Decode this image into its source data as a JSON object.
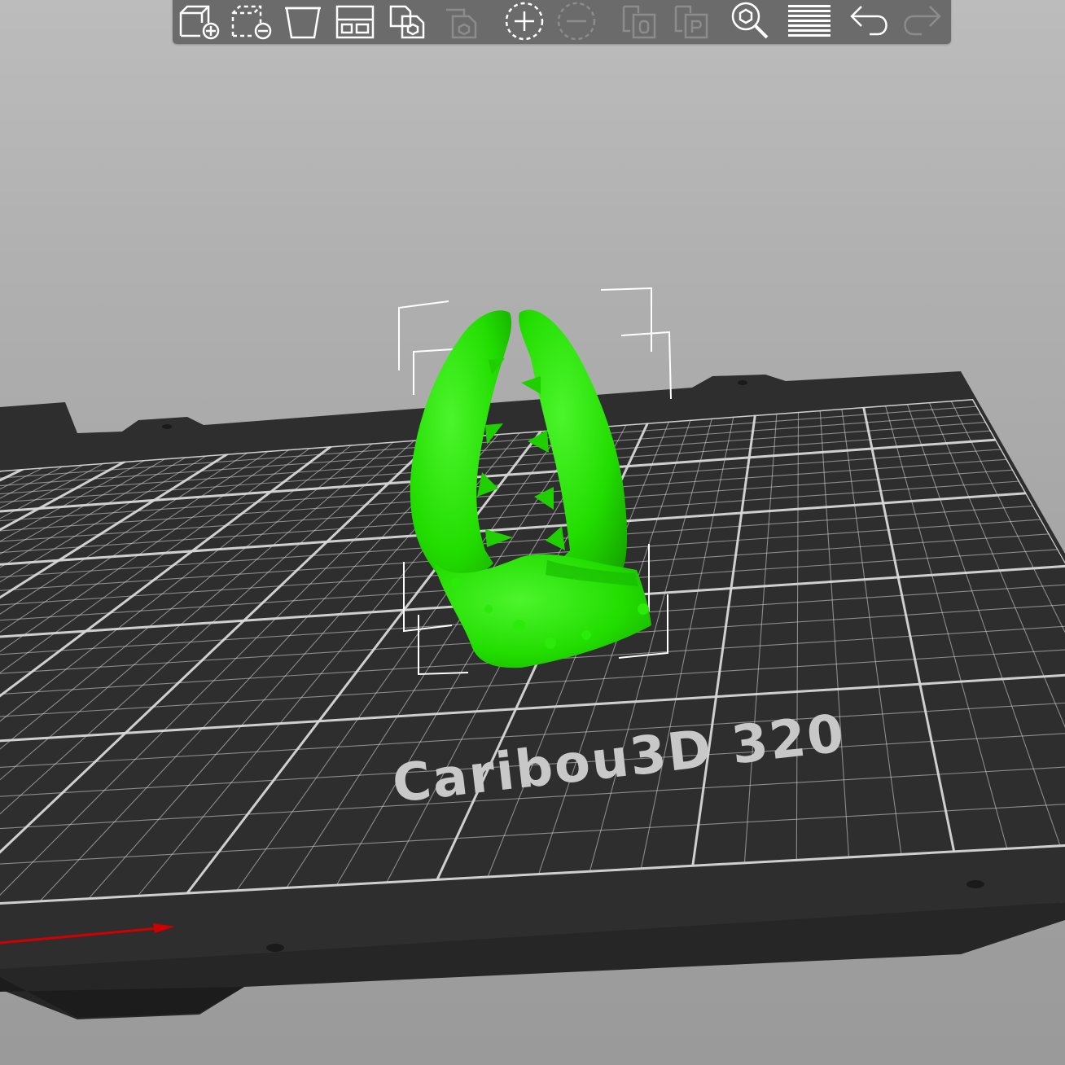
{
  "toolbar": {
    "buttons": [
      {
        "name": "add-object-button",
        "icon": "add-object-icon",
        "enabled": true
      },
      {
        "name": "delete-object-button",
        "icon": "delete-object-icon",
        "enabled": true
      },
      {
        "name": "delete-all-button",
        "icon": "delete-all-icon",
        "enabled": true
      },
      {
        "name": "arrange-button",
        "icon": "arrange-icon",
        "enabled": true
      },
      {
        "name": "copy-button",
        "icon": "copy-icon",
        "enabled": true
      },
      {
        "name": "paste-button",
        "icon": "paste-icon",
        "enabled": false
      },
      {
        "name": "add-instance-button",
        "icon": "add-instance-icon",
        "enabled": true
      },
      {
        "name": "remove-instance-button",
        "icon": "remove-instance-icon",
        "enabled": false
      },
      {
        "name": "split-to-objects-button",
        "icon": "split-objects-icon",
        "enabled": false
      },
      {
        "name": "split-to-parts-button",
        "icon": "split-parts-icon",
        "enabled": false
      },
      {
        "name": "search-button",
        "icon": "search-icon",
        "enabled": true
      },
      {
        "name": "variable-layer-height-button",
        "icon": "layers-icon",
        "enabled": true
      },
      {
        "name": "undo-button",
        "icon": "undo-icon",
        "enabled": true
      },
      {
        "name": "redo-button",
        "icon": "redo-icon",
        "enabled": false
      }
    ]
  },
  "bed": {
    "label": "Caribou3D 320",
    "plate_color": "#2e2e2e",
    "grid_color": "#d8d8d8",
    "x_axis_color": "#d00000"
  },
  "model": {
    "name": "crab-claw",
    "color": "#22dd00",
    "selection_box_color": "#ffffff"
  }
}
